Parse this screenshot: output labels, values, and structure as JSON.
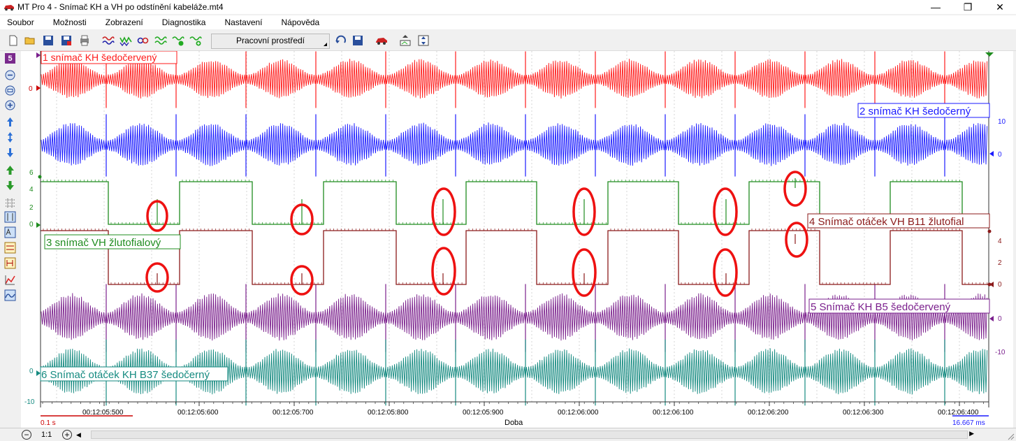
{
  "window": {
    "title": "MT Pro 4 - Snímač KH a VH po odstínění kabeláže.mt4",
    "minimize": "—",
    "maximize": "❐",
    "close": "✕"
  },
  "menu": [
    "Soubor",
    "Možnosti",
    "Zobrazení",
    "Diagnostika",
    "Nastavení",
    "Nápověda"
  ],
  "toolbar": {
    "workspace_label": "Pracovní prostředí"
  },
  "left_strip": {
    "channel_count": "5"
  },
  "channels": [
    {
      "id": 1,
      "label": "1 snímač KH šedočervený",
      "color": "#ff1a1a",
      "label_bg": "#ffffff"
    },
    {
      "id": 2,
      "label": "2 snímač KH šedočerný",
      "color": "#1a1aff",
      "label_bg": "#ffffff"
    },
    {
      "id": 3,
      "label": "3 snímač VH žlutofialový",
      "color": "#1f8c1f",
      "label_bg": "#ffffff"
    },
    {
      "id": 4,
      "label": "4 Snímač otáček VH B11 žlutofial",
      "color": "#8b1a1a",
      "label_bg": "#ffffff"
    },
    {
      "id": 5,
      "label": "5 Snímač KH B5 šedočervený",
      "color": "#7a1f8c",
      "label_bg": "#ffffff"
    },
    {
      "id": 6,
      "label": "6 Snímač otáček KH B37 šedočerný",
      "color": "#158a80",
      "label_bg": "#ffffff"
    }
  ],
  "left_axis_labels": {
    "ch1_zero": "0",
    "ch3": [
      "6",
      "4",
      "2",
      "0"
    ],
    "ch6": [
      "0",
      "-10"
    ]
  },
  "right_axis_labels": {
    "ch2": [
      "10",
      "0"
    ],
    "ch4": [
      "4",
      "2",
      "0"
    ],
    "ch5": [
      "0",
      "-10"
    ]
  },
  "time_axis": {
    "ticks": [
      "00:12:05:500",
      "00:12:05:600",
      "00:12:05:700",
      "00:12:05:800",
      "00:12:05:900",
      "00:12:06:000",
      "00:12:06:100",
      "00:12:06:200",
      "00:12:06:300",
      "00:12:06:400"
    ],
    "label": "Doba",
    "scale_left": "0.1 s",
    "scale_right": "16.667 ms"
  },
  "bottom": {
    "zoom_out": "−",
    "ratio": "1:1",
    "zoom_in": "+",
    "scroll_left": "◀",
    "scroll_right": "▶"
  },
  "colors": {
    "highlight_circle": "#ee1111",
    "grid": "#bbbbbb"
  }
}
